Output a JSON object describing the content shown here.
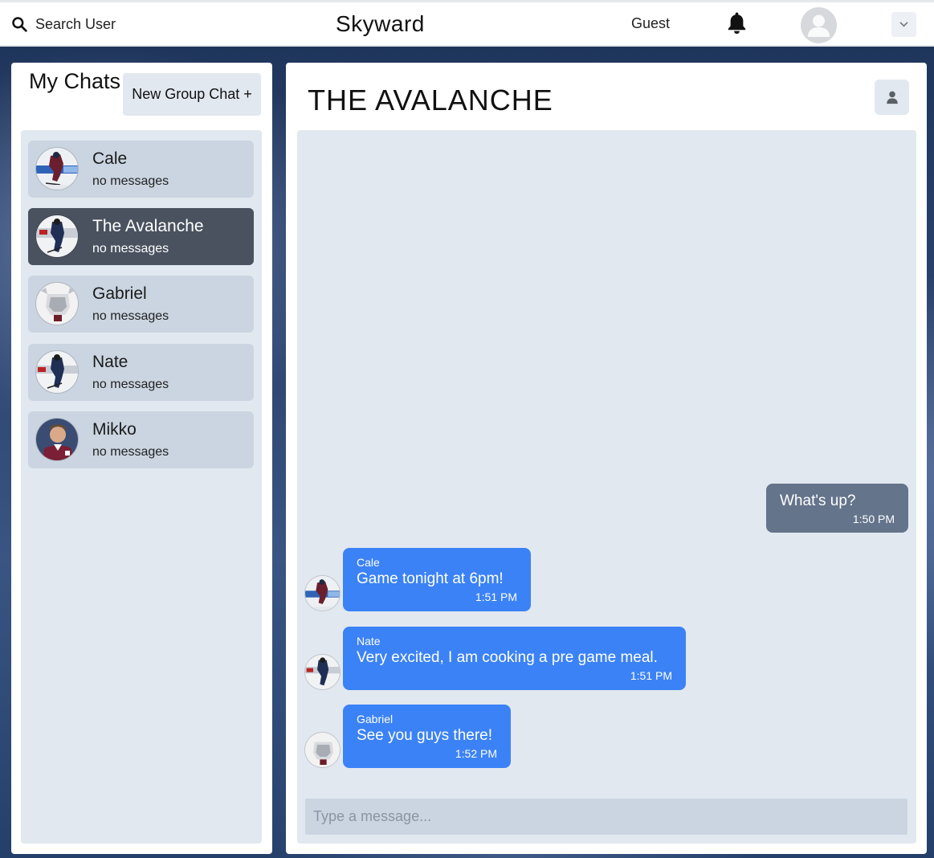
{
  "header": {
    "search_label": "Search User",
    "app_title": "Skyward",
    "user_label": "Guest"
  },
  "sidebar": {
    "title": "My Chats",
    "new_group_label": "New Group Chat +",
    "chats": [
      {
        "name": "Cale",
        "subtitle": "no messages",
        "active": false
      },
      {
        "name": "The Avalanche",
        "subtitle": "no messages",
        "active": true
      },
      {
        "name": "Gabriel",
        "subtitle": "no messages",
        "active": false
      },
      {
        "name": "Nate",
        "subtitle": "no messages",
        "active": false
      },
      {
        "name": "Mikko",
        "subtitle": "no messages",
        "active": false
      }
    ]
  },
  "chat": {
    "title": "THE AVALANCHE",
    "messages": [
      {
        "sender": "",
        "text": "What's up?",
        "time": "1:50 PM",
        "mine": true
      },
      {
        "sender": "Cale",
        "text": "Game tonight at 6pm!",
        "time": "1:51 PM",
        "mine": false
      },
      {
        "sender": "Nate",
        "text": "Very excited, I am cooking a pre game meal.",
        "time": "1:51 PM",
        "mine": false
      },
      {
        "sender": "Gabriel",
        "text": "See you guys there!",
        "time": "1:52 PM",
        "mine": false
      }
    ],
    "input_placeholder": "Type a message..."
  },
  "colors": {
    "active_chat": "#4a5260",
    "chat_item": "#cbd5e1",
    "my_bubble": "#64748b",
    "their_bubble": "#3b82f6",
    "panel_inner": "#e2e8f0"
  }
}
